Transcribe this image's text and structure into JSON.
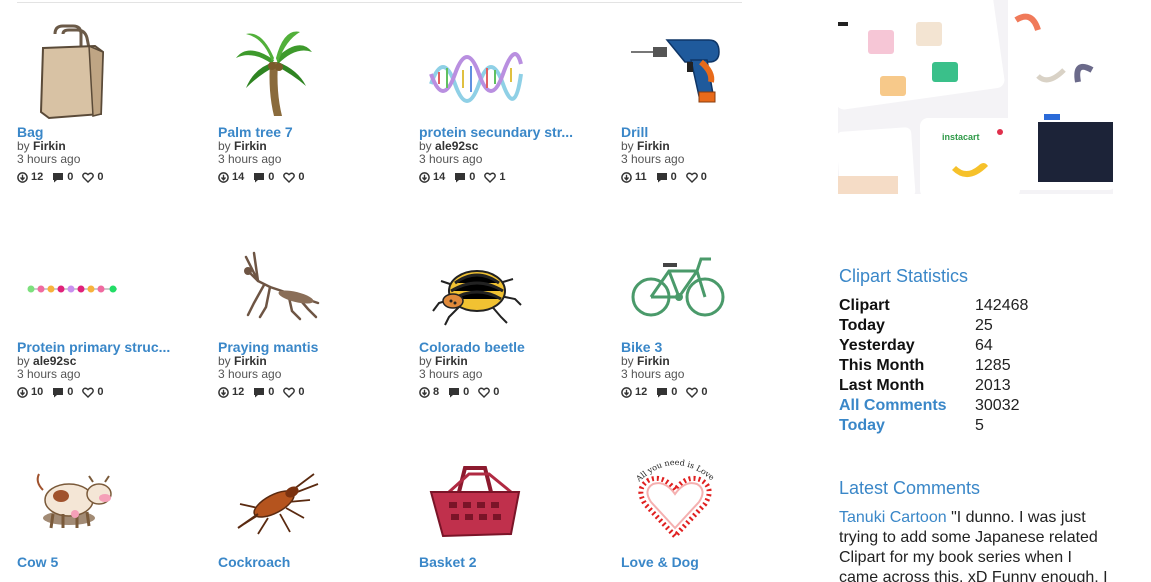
{
  "cards": [
    {
      "title": "Bag",
      "by": "by",
      "author": "Firkin",
      "time": "3 hours ago",
      "downloads": "12",
      "comments": "0",
      "likes": "0"
    },
    {
      "title": "Palm tree 7",
      "by": "by",
      "author": "Firkin",
      "time": "3 hours ago",
      "downloads": "14",
      "comments": "0",
      "likes": "0"
    },
    {
      "title": "protein secundary str...",
      "by": "by",
      "author": "ale92sc",
      "time": "3 hours ago",
      "downloads": "14",
      "comments": "0",
      "likes": "1"
    },
    {
      "title": "Drill",
      "by": "by",
      "author": "Firkin",
      "time": "3 hours ago",
      "downloads": "11",
      "comments": "0",
      "likes": "0"
    },
    {
      "title": "Protein primary struc...",
      "by": "by",
      "author": "ale92sc",
      "time": "3 hours ago",
      "downloads": "10",
      "comments": "0",
      "likes": "0"
    },
    {
      "title": "Praying mantis",
      "by": "by",
      "author": "Firkin",
      "time": "3 hours ago",
      "downloads": "12",
      "comments": "0",
      "likes": "0"
    },
    {
      "title": "Colorado beetle",
      "by": "by",
      "author": "Firkin",
      "time": "3 hours ago",
      "downloads": "8",
      "comments": "0",
      "likes": "0"
    },
    {
      "title": "Bike 3",
      "by": "by",
      "author": "Firkin",
      "time": "3 hours ago",
      "downloads": "12",
      "comments": "0",
      "likes": "0"
    },
    {
      "title": "Cow 5"
    },
    {
      "title": "Cockroach"
    },
    {
      "title": "Basket 2"
    },
    {
      "title": "Love & Dog"
    }
  ],
  "sidebar": {
    "stats_title": "Clipart Statistics",
    "stats": [
      {
        "label": "Clipart",
        "value": "142468"
      },
      {
        "label": "Today",
        "value": "25"
      },
      {
        "label": "Yesterday",
        "value": "64"
      },
      {
        "label": "This Month",
        "value": "1285"
      },
      {
        "label": "Last Month",
        "value": "2013"
      },
      {
        "label": "All Comments",
        "value": "30032"
      },
      {
        "label": "Today",
        "value": "5"
      }
    ],
    "latest_title": "Latest Comments",
    "comment_author": "Tanuki Cartoon",
    "comment_text": " \"I dunno. I was just trying to add some Japanese related Clipart for my book series when I came across this. xD Funny enough, I",
    "ad_brand": "instacart",
    "heart_text": "All you need is Love and a dog!!"
  },
  "colors": {
    "link": "#3a87c8",
    "divider": "#e3e3e3"
  }
}
